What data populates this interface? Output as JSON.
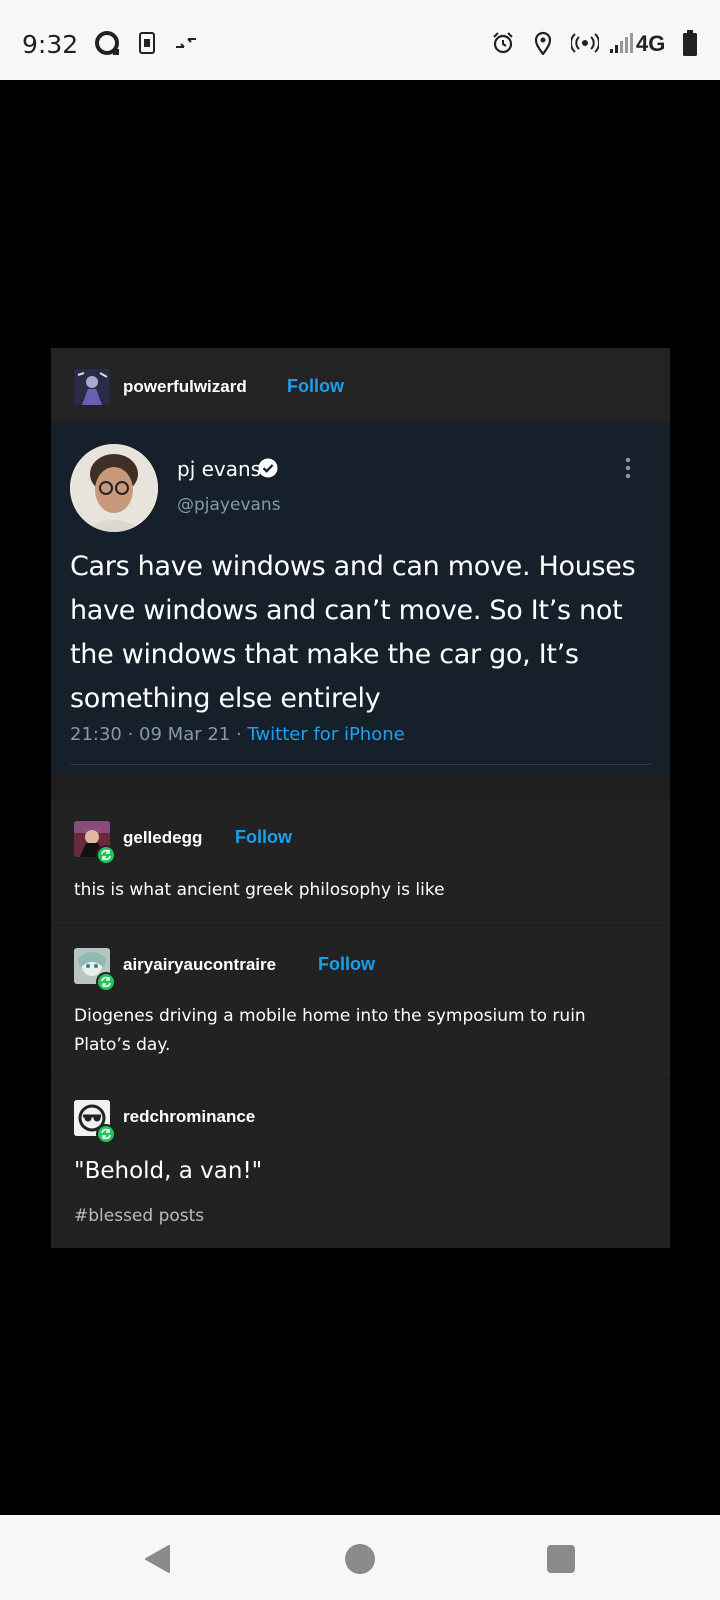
{
  "status_bar": {
    "time": "9:32",
    "network": "4G",
    "icons": [
      "circle-app-icon",
      "sim-icon",
      "data-arrows-icon",
      "alarm-icon",
      "location-icon",
      "hotspot-icon",
      "signal-icon",
      "battery-icon"
    ]
  },
  "post": {
    "op": {
      "username": "powerfulwizard",
      "follow_label": "Follow"
    },
    "tweet": {
      "name": "pj evans",
      "handle": "@pjayevans",
      "text": "Cars have windows and can move. Houses have windows and can’t move. So It’s not the windows that make the car go, It’s something else entirely",
      "timestamp": "21:30 · 09 Mar 21 · ",
      "source": "Twitter for iPhone"
    },
    "reblogs": [
      {
        "username": "gelledegg",
        "follow_label": "Follow",
        "text": "this is what ancient greek philosophy is like"
      },
      {
        "username": "airyairyaucontraire",
        "follow_label": "Follow",
        "text": "Diogenes driving a mobile home into the symposium to ruin Plato’s day."
      },
      {
        "username": "redchrominance",
        "text": "\"Behold, a van!\"",
        "tag": "#blessed posts"
      }
    ]
  },
  "colors": {
    "follow": "#1a9ff0",
    "tweet_bg": "#15202b",
    "card_bg": "#222222",
    "reblog_badge": "#22c55e"
  }
}
